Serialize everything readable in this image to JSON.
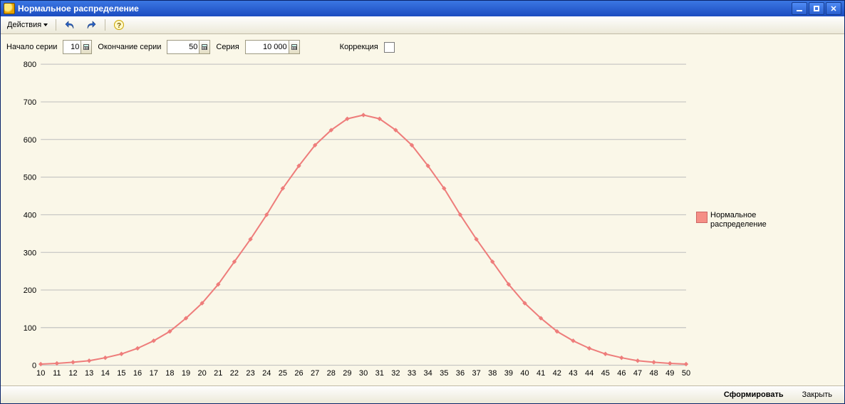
{
  "window": {
    "title": "Нормальное распределение"
  },
  "toolbar": {
    "actions_label": "Действия"
  },
  "params": {
    "start_label": "Начало серии",
    "start_value": "10",
    "end_label": "Окончание серии",
    "end_value": "50",
    "series_label": "Серия",
    "series_value": "10 000",
    "correction_label": "Коррекция",
    "correction_checked": false
  },
  "legend": {
    "series_name": "Нормальное\nраспределение"
  },
  "buttons": {
    "generate": "Сформировать",
    "close": "Закрыть"
  },
  "chart_data": {
    "type": "line",
    "title": "",
    "xlabel": "",
    "ylabel": "",
    "ylim": [
      0,
      800
    ],
    "yticks": [
      0,
      100,
      200,
      300,
      400,
      500,
      600,
      700,
      800
    ],
    "categories": [
      10,
      11,
      12,
      13,
      14,
      15,
      16,
      17,
      18,
      19,
      20,
      21,
      22,
      23,
      24,
      25,
      26,
      27,
      28,
      29,
      30,
      31,
      32,
      33,
      34,
      35,
      36,
      37,
      38,
      39,
      40,
      41,
      42,
      43,
      44,
      45,
      46,
      47,
      48,
      49,
      50
    ],
    "series": [
      {
        "name": "Нормальное распределение",
        "values": [
          3,
          5,
          8,
          12,
          20,
          30,
          45,
          65,
          90,
          125,
          165,
          215,
          275,
          335,
          400,
          470,
          530,
          585,
          625,
          655,
          665,
          655,
          625,
          585,
          530,
          470,
          400,
          335,
          275,
          215,
          165,
          125,
          90,
          65,
          45,
          30,
          20,
          12,
          8,
          5,
          3
        ]
      }
    ],
    "legend_position": "right",
    "grid": "horizontal"
  }
}
